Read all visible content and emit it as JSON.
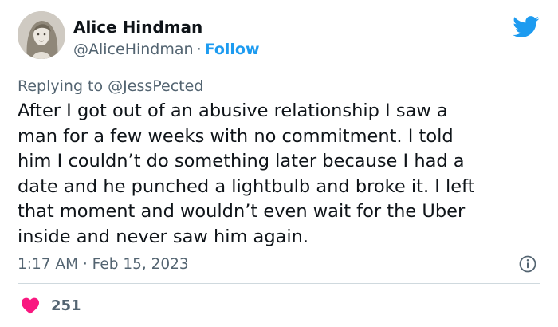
{
  "author": {
    "name": "Alice Hindman",
    "handle": "@AliceHindman",
    "separator": "·",
    "follow_label": "Follow"
  },
  "reply_context": {
    "prefix": "Replying to",
    "handle": "@JessPected"
  },
  "tweet": {
    "lines": [
      "After I got out of an abusive relationship I saw a",
      "man for a few weeks with no commitment. I told",
      "him I couldn’t do something later because I had a",
      "date and he punched a lightbulb and broke it. I left",
      "that moment and wouldn’t even wait for the Uber",
      "inside and never saw him again."
    ],
    "timestamp": "1:17 AM · Feb 15, 2023",
    "likes": "251"
  },
  "icons": {
    "brand": "twitter-bird-icon",
    "info": "info-icon",
    "like": "heart-icon"
  },
  "colors": {
    "brand_blue": "#1d9bf0",
    "like_red": "#f91880",
    "secondary_text": "#536471",
    "primary_text": "#0f1419",
    "divider": "#cfd9de"
  }
}
